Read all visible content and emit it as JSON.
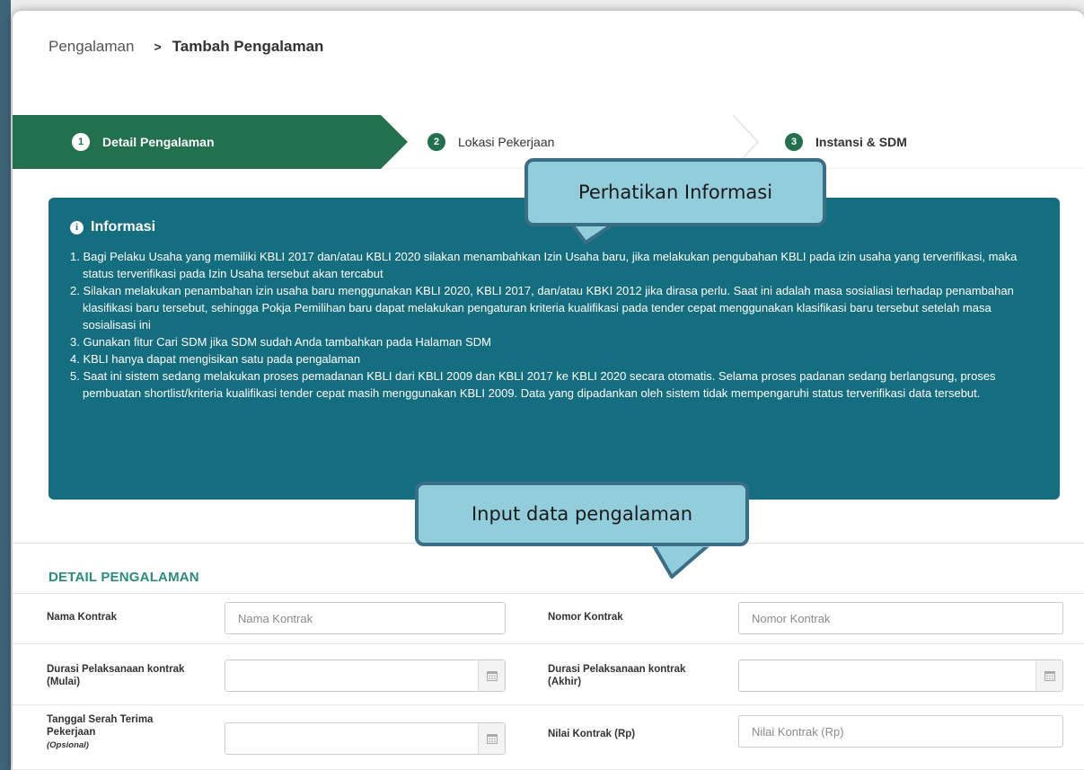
{
  "breadcrumb": {
    "parent": "Pengalaman",
    "separator": ">",
    "current": "Tambah Pengalaman"
  },
  "steps": [
    {
      "num": "1",
      "label": "Detail Pengalaman",
      "active": true
    },
    {
      "num": "2",
      "label": "Lokasi Pekerjaan",
      "active": false
    },
    {
      "num": "3",
      "label": "Instansi & SDM",
      "active": false
    }
  ],
  "info": {
    "icon": "info-icon",
    "icon_glyph": "i",
    "title": "Informasi",
    "items": [
      "1. Bagi Pelaku Usaha yang memiliki KBLI 2017 dan/atau KBLI 2020 silakan menambahkan Izin Usaha baru, jika melakukan pengubahan KBLI pada izin usaha yang terverifikasi, maka status terverifikasi pada Izin Usaha tersebut akan tercabut",
      "2. Silakan melakukan penambahan izin usaha baru menggunakan KBLI 2020, KBLI 2017, dan/atau KBKI 2012 jika dirasa perlu. Saat ini adalah masa sosialiasi terhadap penambahan klasifikasi baru tersebut, sehingga Pokja Pemilihan baru dapat melakukan pengaturan kriteria kualifikasi pada tender cepat menggunakan klasifikasi baru tersebut setelah masa sosialisasi ini",
      "3. Gunakan fitur Cari SDM jika SDM sudah Anda tambahkan pada Halaman SDM",
      "4. KBLI hanya dapat mengisikan satu pada pengalaman",
      "5. Saat ini sistem sedang melakukan proses pemadanan KBLI dari KBLI 2009 dan KBLI 2017 ke KBLI 2020 secara otomatis. Selama proses padanan sedang berlangsung, proses pembuatan shortlist/kriteria kualifikasi tender cepat masih menggunakan KBLI 2009. Data yang dipadankan oleh sistem tidak mempengaruhi status terverifikasi data tersebut."
    ]
  },
  "callouts": {
    "info": "Perhatikan Informasi",
    "input": "Input data pengalaman"
  },
  "form": {
    "section_title": "DETAIL PENGALAMAN",
    "nama_kontrak": {
      "label": "Nama Kontrak",
      "placeholder": "Nama Kontrak",
      "value": ""
    },
    "nomor_kontrak": {
      "label": "Nomor Kontrak",
      "placeholder": "Nomor Kontrak",
      "value": ""
    },
    "durasi_mulai": {
      "label": "Durasi Pelaksanaan kontrak (Mulai)",
      "value": ""
    },
    "durasi_akhir": {
      "label": "Durasi Pelaksanaan kontrak (Akhir)",
      "value": ""
    },
    "tanggal_serah": {
      "label": "Tanggal Serah Terima Pekerjaan",
      "optional": "(Opsional)",
      "value": ""
    },
    "nilai_kontrak": {
      "label": "Nilai Kontrak (Rp)",
      "placeholder": "Nilai Kontrak (Rp)",
      "value": ""
    }
  },
  "colors": {
    "accent": "#23704f",
    "info_bg": "#156e80",
    "section_title": "#2a8c7c",
    "callout_bg": "#92cddc",
    "callout_border": "#3a6d86"
  }
}
